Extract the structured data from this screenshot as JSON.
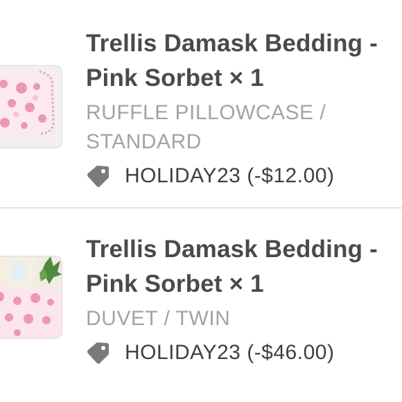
{
  "line_items": [
    {
      "title": "Trellis Damask Bedding - Pink Sorbet × 1",
      "variant": "RUFFLE PILLOWCASE / STANDARD",
      "discount_code": "HOLIDAY23",
      "discount_amount": "(-$12.00)",
      "icon": "tag-icon"
    },
    {
      "title": "Trellis Damask Bedding - Pink Sorbet × 1",
      "variant": "DUVET / TWIN",
      "discount_code": "HOLIDAY23",
      "discount_amount": "(-$46.00)",
      "icon": "tag-icon"
    }
  ],
  "colors": {
    "title": "#4a4a4a",
    "variant": "#a3a3a3",
    "tag_icon": "#7a7a7a",
    "divider": "#e4e4e4",
    "damask_pink": "#e88aa6"
  }
}
